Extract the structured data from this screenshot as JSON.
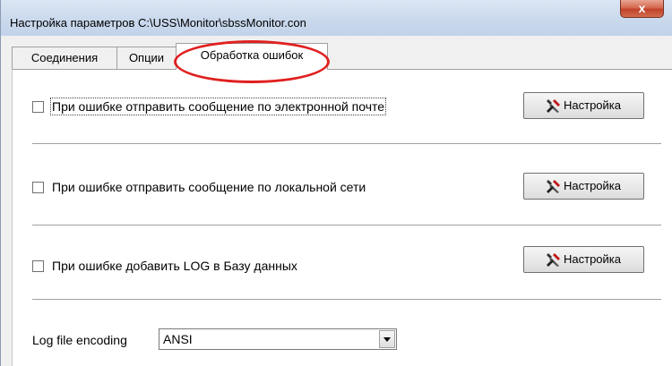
{
  "window": {
    "title": "Настройка параметров C:\\USS\\Monitor\\sbssMonitor.con",
    "close_label": "x"
  },
  "tabs": [
    {
      "label": "Соединения",
      "active": false
    },
    {
      "label": "Опции",
      "active": false
    },
    {
      "label": "Обработка ошибок",
      "active": true
    }
  ],
  "options": [
    {
      "label": "При ошибке отправить сообщение по электронной почте",
      "checked": false,
      "button_label": "Настройка",
      "button_icon": "tools-icon"
    },
    {
      "label": "При ошибке отправить сообщение по локальной сети",
      "checked": false,
      "button_label": "Настройка",
      "button_icon": "tools-icon"
    },
    {
      "label": "При ошибке добавить LOG в Базу данных",
      "checked": false,
      "button_label": "Настройка",
      "button_icon": "tools-icon"
    }
  ],
  "log_encoding": {
    "label": "Log file encoding",
    "value": "ANSI"
  },
  "colors": {
    "highlight": "#e02020",
    "close_button": "#c0432a"
  }
}
